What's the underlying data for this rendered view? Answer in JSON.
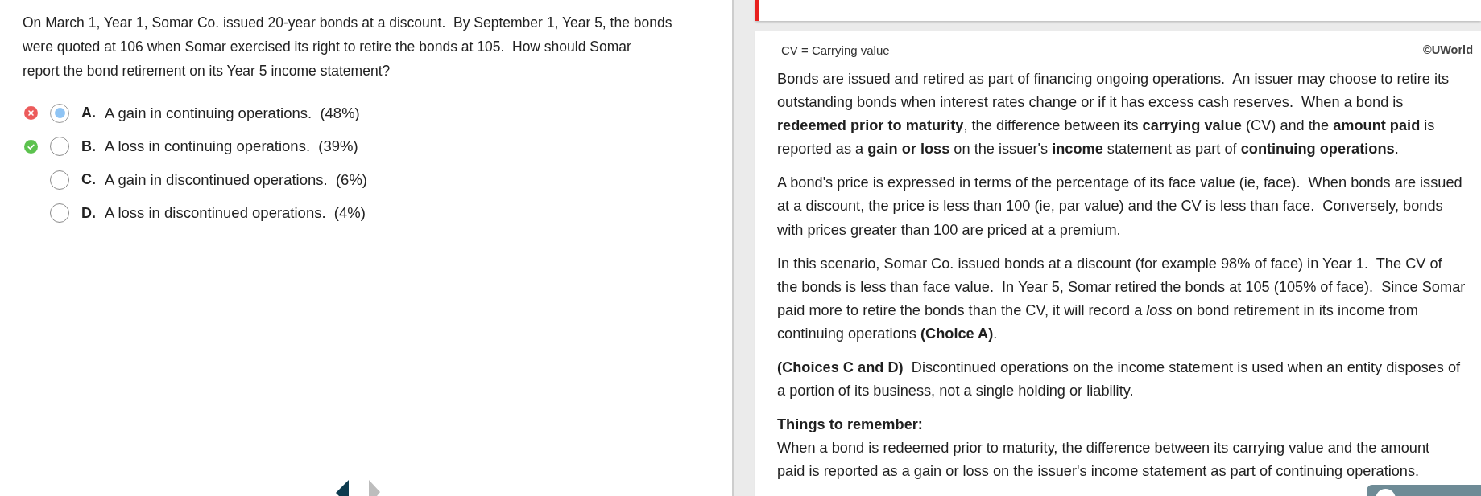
{
  "question": {
    "lines": [
      "On March 1, Year 1, Somar Co. issued 20-year bonds at a discount.  By September 1, Year 5, the bonds",
      "were quoted at 106 when Somar exercised its right to retire the bonds at 105.  How should Somar",
      "report the bond retirement on its Year 5 income statement?"
    ]
  },
  "choices": [
    {
      "kind": "incorrect",
      "letter": "A.",
      "text": "A gain in continuing operations.  (48%)",
      "selected": true
    },
    {
      "kind": "correct",
      "letter": "B.",
      "text": "A loss in continuing operations.  (39%)",
      "selected": false
    },
    {
      "kind": "plain",
      "letter": "C.",
      "text": "A gain in discontinued operations.  (6%)",
      "selected": false
    },
    {
      "kind": "plain",
      "letter": "D.",
      "text": "A loss in discontinued operations.  (4%)",
      "selected": false
    }
  ],
  "navigation": [
    {
      "kind": "previous",
      "disabled": false
    },
    {
      "kind": "next",
      "disabled": true
    }
  ],
  "result_banner": {
    "incorrect": true
  },
  "explanation": {
    "note": "CV = Carrying value",
    "copyright": "©UWorld",
    "paragraphs": [
      {
        "lines": [
          "Bonds are issued and retired as part of financing ongoing operations.  An issuer may choose to retire its",
          "outstanding bonds when interest rates change or if it has excess cash reserves.  When a bond is",
          "**redeemed prior to maturity**, the difference between its **carrying value** (CV) and the **amount paid** is",
          "reported as a **gain or loss** on the issuer's **income** statement as part of **continuing operations**."
        ]
      },
      {
        "lines": [
          "A bond's price is expressed in terms of the percentage of its face value (ie, face).  When bonds are issued",
          "at a discount, the price is less than 100 (ie, par value) and the CV is less than face.  Conversely, bonds",
          "with prices greater than 100 are priced at a premium."
        ]
      },
      {
        "lines": [
          "In this scenario, Somar Co. issued bonds at a discount (for example 98% of face) in Year 1.  The CV of",
          "the bonds is less than face value.  In Year 5, Somar retired the bonds at 105 (105% of face).  Since Somar",
          "paid more to retire the bonds than the CV, it will record a *loss* on bond retirement in its income from",
          "continuing operations **(Choice A)**."
        ]
      },
      {
        "lines": [
          "**(Choices C and D)**  Discontinued operations on the income statement is used when an entity disposes of",
          "a portion of its business, not a single holding or liability."
        ]
      }
    ],
    "summary": {
      "heading": "Things to remember:",
      "lines": [
        "When a bond is redeemed prior to maturity, the difference between its carrying value and the amount",
        "paid is reported as a gain or loss on the issuer's income statement as part of continuing operations."
      ]
    }
  }
}
